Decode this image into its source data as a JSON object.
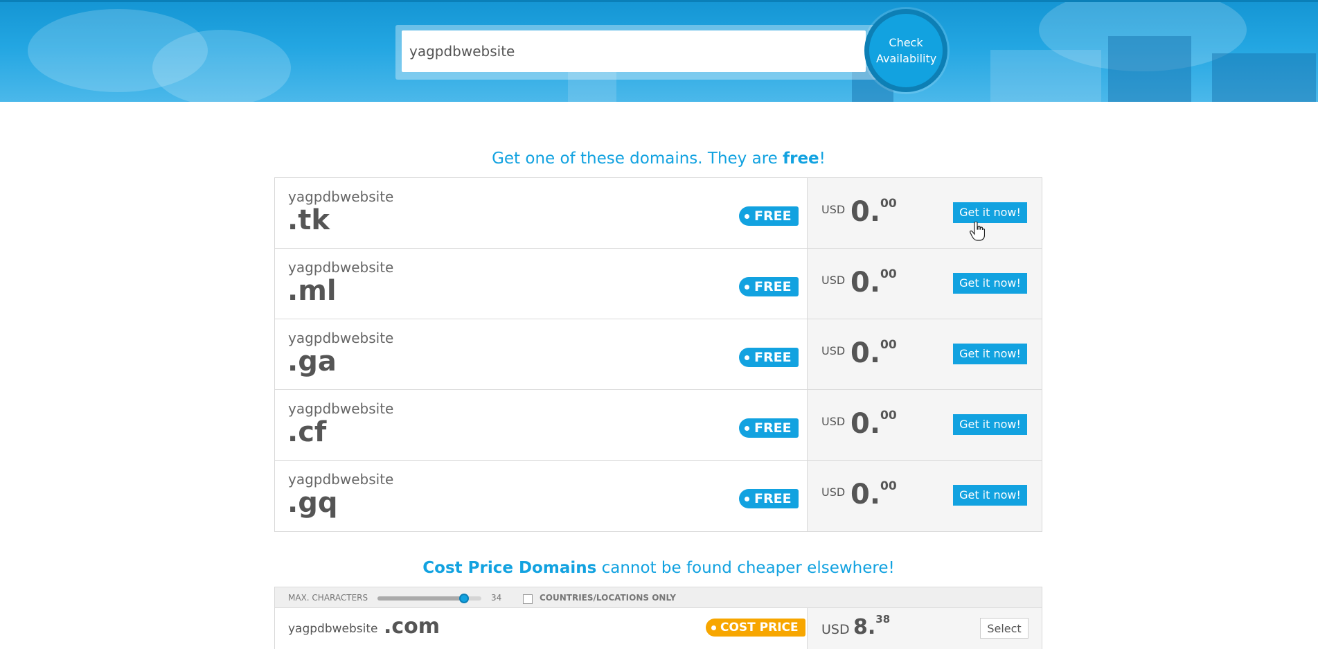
{
  "search": {
    "value": "yagpdbwebsite",
    "button_label": "Check Availability"
  },
  "free_section": {
    "heading_prefix": "Get one of these domains. They are ",
    "heading_bold": "free",
    "heading_suffix": "!",
    "rows": [
      {
        "name": "yagpdbwebsite",
        "tld": ".tk",
        "badge": "FREE",
        "currency": "USD",
        "price_int": "0.",
        "price_dec": "00",
        "button": "Get it now!"
      },
      {
        "name": "yagpdbwebsite",
        "tld": ".ml",
        "badge": "FREE",
        "currency": "USD",
        "price_int": "0.",
        "price_dec": "00",
        "button": "Get it now!"
      },
      {
        "name": "yagpdbwebsite",
        "tld": ".ga",
        "badge": "FREE",
        "currency": "USD",
        "price_int": "0.",
        "price_dec": "00",
        "button": "Get it now!"
      },
      {
        "name": "yagpdbwebsite",
        "tld": ".cf",
        "badge": "FREE",
        "currency": "USD",
        "price_int": "0.",
        "price_dec": "00",
        "button": "Get it now!"
      },
      {
        "name": "yagpdbwebsite",
        "tld": ".gq",
        "badge": "FREE",
        "currency": "USD",
        "price_int": "0.",
        "price_dec": "00",
        "button": "Get it now!"
      }
    ]
  },
  "cost_section": {
    "heading_bold": "Cost Price Domains",
    "heading_rest": " cannot be found cheaper elsewhere!",
    "filter": {
      "max_chars_label": "MAX. CHARACTERS",
      "max_chars_value": "34",
      "slider_fraction": 0.83,
      "countries_label": "COUNTRIES/LOCATIONS ONLY"
    },
    "rows": [
      {
        "name": "yagpdbwebsite",
        "tld": ".com",
        "badge": "COST PRICE",
        "currency": "USD",
        "price_int": "8.",
        "price_dec": "38",
        "button": "Select"
      }
    ]
  },
  "colors": {
    "accent": "#12a2e0",
    "cost_badge": "#f7a600"
  }
}
